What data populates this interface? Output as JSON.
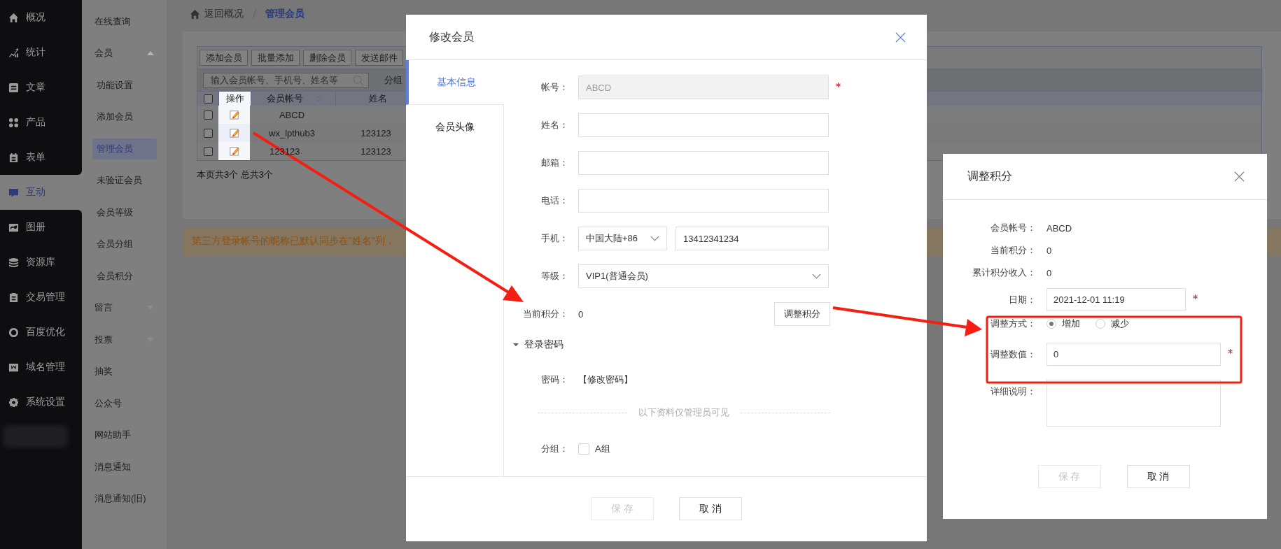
{
  "main_nav": [
    {
      "label": "概况",
      "selected": false
    },
    {
      "label": "统计",
      "selected": false
    },
    {
      "label": "文章",
      "selected": false
    },
    {
      "label": "产品",
      "selected": false
    },
    {
      "label": "表单",
      "selected": false
    },
    {
      "label": "互动",
      "selected": true
    },
    {
      "label": "图册",
      "selected": false
    },
    {
      "label": "资源库",
      "selected": false
    },
    {
      "label": "交易管理",
      "selected": false
    },
    {
      "label": "百度优化",
      "selected": false
    },
    {
      "label": "域名管理",
      "selected": false
    },
    {
      "label": "系统设置",
      "selected": false
    }
  ],
  "sub_nav": [
    {
      "label": "在线查询",
      "kind": "link",
      "selected": false
    },
    {
      "label": "会员",
      "kind": "group",
      "expanded": true,
      "selected": false
    },
    {
      "label": "功能设置",
      "kind": "sub",
      "selected": false
    },
    {
      "label": "添加会员",
      "kind": "sub",
      "selected": false
    },
    {
      "label": "管理会员",
      "kind": "sub",
      "selected": true
    },
    {
      "label": "未验证会员",
      "kind": "sub",
      "selected": false
    },
    {
      "label": "会员等级",
      "kind": "sub",
      "selected": false
    },
    {
      "label": "会员分组",
      "kind": "sub",
      "selected": false
    },
    {
      "label": "会员积分",
      "kind": "sub",
      "selected": false
    },
    {
      "label": "留言",
      "kind": "group",
      "expanded": false,
      "selected": false
    },
    {
      "label": "投票",
      "kind": "group",
      "expanded": false,
      "selected": false
    },
    {
      "label": "抽奖",
      "kind": "link",
      "selected": false
    },
    {
      "label": "公众号",
      "kind": "link",
      "selected": false
    },
    {
      "label": "网站助手",
      "kind": "link",
      "selected": false
    },
    {
      "label": "消息通知",
      "kind": "link",
      "selected": false
    },
    {
      "label": "消息通知(旧)",
      "kind": "link",
      "selected": false
    }
  ],
  "breadcrumb": {
    "back": "返回概况",
    "current": "管理会员"
  },
  "toolbar": [
    "添加会员",
    "批量添加",
    "删除会员",
    "发送邮件"
  ],
  "search": {
    "placeholder": "输入会员帐号、手机号、姓名等"
  },
  "filter_label": "分组",
  "table": {
    "header_checked": false,
    "columns": [
      {
        "label": "操作",
        "sortable": false
      },
      {
        "label": "会员帐号",
        "sortable": true
      },
      {
        "label": "姓名",
        "sortable": false
      }
    ],
    "rows": [
      {
        "checked": false,
        "cells": [
          "",
          "ABCD"
        ]
      },
      {
        "checked": false,
        "cells": [
          "",
          "wx_lpthub3",
          "123123"
        ]
      },
      {
        "checked": false,
        "cells": [
          "",
          "123123",
          "123123"
        ]
      }
    ]
  },
  "page_summary": "本页共3个 总共3个",
  "notice": "第三方登录帐号的昵称已默认同步在\"姓名\"列，",
  "edit_dialog": {
    "title": "修改会员",
    "tabs": [
      {
        "label": "基本信息",
        "selected": true
      },
      {
        "label": "会员头像",
        "selected": false
      }
    ],
    "fields": [
      {
        "label": "帐号：",
        "kind": "input",
        "value": "ABCD",
        "disabled": true,
        "required": true
      },
      {
        "label": "姓名：",
        "kind": "input",
        "disabled": false,
        "required": false
      },
      {
        "label": "邮箱：",
        "kind": "input",
        "disabled": false,
        "required": false
      },
      {
        "label": "电话：",
        "kind": "input",
        "disabled": false,
        "required": false
      },
      {
        "label": "手机：",
        "kind": "phone",
        "region": "中国大陆+86",
        "value": "13412341234",
        "disabled": false,
        "required": false
      },
      {
        "label": "等级：",
        "kind": "select",
        "value": "VIP1(普通会员)",
        "disabled": false,
        "required": false
      },
      {
        "label": "当前积分：",
        "kind": "points",
        "value": "0",
        "button": "调整积分",
        "disabled": false,
        "required": false
      }
    ],
    "password_section": {
      "title": "登录密码",
      "expanded": true,
      "label": "密码：",
      "link": "【修改密码】"
    },
    "divider_text": "以下资料仅管理员可见",
    "group": {
      "label": "分组：",
      "options": [
        {
          "label": "A组",
          "checked": false
        }
      ]
    },
    "buttons": [
      {
        "label": "保 存",
        "disabled": true
      },
      {
        "label": "取 消",
        "disabled": false
      }
    ]
  },
  "adjust_dialog": {
    "title": "调整积分",
    "info": [
      {
        "label": "会员帐号：",
        "value": "ABCD"
      },
      {
        "label": "当前积分：",
        "value": "0"
      },
      {
        "label": "累计积分收入：",
        "value": "0"
      }
    ],
    "date": {
      "label": "日期：",
      "value": "2021-12-01 11:19",
      "required": true
    },
    "method": {
      "label": "调整方式：",
      "options": [
        {
          "label": "增加",
          "selected": true
        },
        {
          "label": "减少",
          "selected": false
        }
      ]
    },
    "amount": {
      "label": "调整数值：",
      "value": "0",
      "required": true
    },
    "detail": {
      "label": "详细说明："
    },
    "buttons": [
      {
        "label": "保 存",
        "disabled": true
      },
      {
        "label": "取 消",
        "disabled": false
      }
    ]
  }
}
